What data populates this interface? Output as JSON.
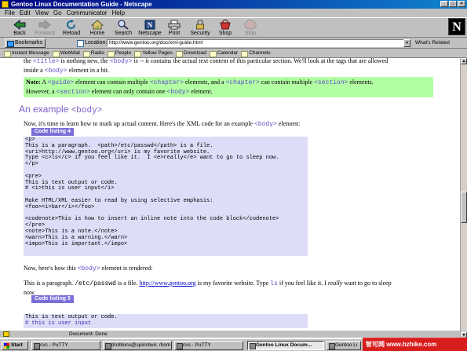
{
  "window": {
    "title": "Gentoo Linux Documentation Guide - Netscape"
  },
  "menu": [
    "File",
    "Edit",
    "View",
    "Go",
    "Communicator",
    "Help"
  ],
  "toolbar": {
    "buttons": [
      {
        "label": "Back",
        "icon": "back-arrow-icon"
      },
      {
        "label": "Forward",
        "icon": "forward-arrow-icon"
      },
      {
        "label": "Reload",
        "icon": "reload-icon"
      },
      {
        "label": "Home",
        "icon": "home-icon"
      },
      {
        "label": "Search",
        "icon": "search-icon"
      },
      {
        "label": "Netscape",
        "icon": "netscape-icon"
      },
      {
        "label": "Print",
        "icon": "print-icon"
      },
      {
        "label": "Security",
        "icon": "lock-icon"
      },
      {
        "label": "Shop",
        "icon": "shop-icon"
      },
      {
        "label": "Stop",
        "icon": "stop-icon"
      }
    ],
    "logo": "N"
  },
  "location": {
    "bookmarks_label": "Bookmarks",
    "location_label": "Location:",
    "url": "http://www.gentoo.org/doc/xml-guide.html",
    "related_label": "What's Related"
  },
  "personal_toolbar": [
    "Instant Message",
    "WebMail",
    "Radio",
    "People",
    "Yellow Pages",
    "Download",
    "Calendar",
    "Channels"
  ],
  "content": {
    "intro_line1_pre": "the ",
    "intro_tag1": "<title>",
    "intro_line1_mid": " is nothing new, the ",
    "intro_tag2": "<body>",
    "intro_line1_post": " is -- it contains the actual text content of this particular section. We'll look at the tags that are allowed",
    "intro_line2_pre": "inside a ",
    "intro_tag3": "<body>",
    "intro_line2_post": " element in a bit.",
    "note_label": "Note:",
    "note_a": " A ",
    "note_tag1": "<guide>",
    "note_b": " element can contain multiple ",
    "note_tag2": "<chapter>",
    "note_c": " elements, and a ",
    "note_tag3": "<chapter>",
    "note_d": " can contain multiple ",
    "note_tag4": "<section>",
    "note_e": " elements.",
    "note_f": "However, a ",
    "note_tag5": "<section>",
    "note_g": " element can only contain one ",
    "note_tag6": "<body>",
    "note_h": " element.",
    "heading_pre": "An example ",
    "heading_tag": "<body>",
    "example_pre": "Now, it's time to learn how to mark up actual content. Here's the XML code for an example ",
    "example_tag": "<body>",
    "example_post": " element:",
    "listing4_label": "Code listing 4",
    "listing4_code": "<p>\nThis is a paragraph.  <path>/etc/passwd</path> is a file.\n<uri>http://www.gentoo.org</uri> is my favorite website.\nType <c>ls</c> if you feel like it.  I <e>really</e> want to go to sleep now.\n</p>\n\n<pre>\nThis is text output or code.\n# <i>this is user input</i>\n\nMake HTML/XML easier to read by using selective emphasis:\n<foo><i>bar</i></foo>\n\n<codenote>This is how to insert an inline note into the code block</codenote>\n</pre>\n<note>This is a note.</note>\n<warn>This is a warning.</warn>\n<impo>This is important.</impo>",
    "rendered_pre": "Now, here's how this ",
    "rendered_tag": "<body>",
    "rendered_post": " element is rendered:",
    "para_a": "This is a paragraph. ",
    "para_path": "/etc/passwd",
    "para_b": " is a file. ",
    "para_uri": "http://www.gentoo.org",
    "para_c": " is my favorite website. Type ",
    "para_cmd": "ls",
    "para_d": " if you feel like it. I ",
    "para_em": "really",
    "para_e": " want to go to sleep",
    "para_f": "now.",
    "listing5_label": "Code listing 5",
    "listing5_line1": "This is text output or code.",
    "listing5_line2": "# this is user input"
  },
  "status": {
    "text": "Document: Done"
  },
  "taskbar": {
    "start_label": "Start",
    "tasks": [
      "cvs - PuTTY",
      "drobbins@spinntwo: /hom...",
      "cvs - PuTTY",
      "Gentoo Linux Docum...",
      "Gentoo Li"
    ]
  },
  "watermark": "智可网 www.hzhike.com",
  "colors": {
    "accent": "#7b6fd8",
    "tag": "#5d4fc7",
    "note_bg": "#b3ffa3",
    "code_bg": "#ddddf8"
  }
}
